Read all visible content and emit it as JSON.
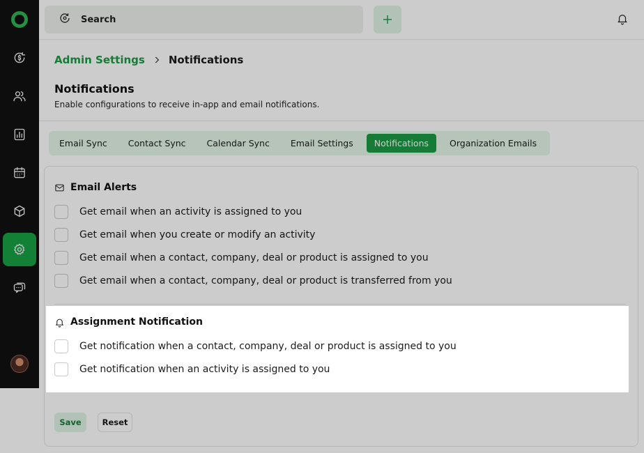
{
  "topbar": {
    "search_placeholder": "Search",
    "add_icon": "plus-icon",
    "notifications_icon": "bell-icon"
  },
  "sidebar": {
    "logo": "app-logo",
    "items": [
      {
        "icon": "dollar-refresh-icon"
      },
      {
        "icon": "contacts-icon"
      },
      {
        "icon": "reports-icon"
      },
      {
        "icon": "calendar-icon"
      },
      {
        "icon": "product-box-icon"
      },
      {
        "icon": "settings-gear-icon",
        "active": true
      },
      {
        "icon": "chat-icon"
      }
    ],
    "avatar": "user-avatar"
  },
  "breadcrumb": {
    "parent": "Admin Settings",
    "current": "Notifications"
  },
  "page": {
    "title": "Notifications",
    "subtitle": "Enable configurations to receive in-app and email notifications."
  },
  "tabs": [
    {
      "label": "Email Sync"
    },
    {
      "label": "Contact Sync"
    },
    {
      "label": "Calendar Sync"
    },
    {
      "label": "Email Settings"
    },
    {
      "label": "Notifications",
      "active": true
    },
    {
      "label": "Organization Emails"
    }
  ],
  "email_alerts": {
    "title": "Email Alerts",
    "options": [
      {
        "label": "Get email when an activity  is assigned to you",
        "checked": false
      },
      {
        "label": "Get email when you create or modify an activity",
        "checked": false
      },
      {
        "label": "Get email when a contact, company, deal or product is assigned to you",
        "checked": false
      },
      {
        "label": "Get email when a contact, company, deal or product is transferred from you",
        "checked": false
      }
    ]
  },
  "assignment_notification": {
    "title": "Assignment Notification",
    "options": [
      {
        "label": "Get notification when a contact, company, deal or product is assigned to you",
        "checked": false
      },
      {
        "label": "Get notification when an activity is assigned to you",
        "checked": false
      }
    ]
  },
  "actions": {
    "save_label": "Save",
    "reset_label": "Reset"
  },
  "colors": {
    "accent": "#1c9a44",
    "accent_light": "#e4f6e9",
    "sidebar_bg": "#111111"
  }
}
